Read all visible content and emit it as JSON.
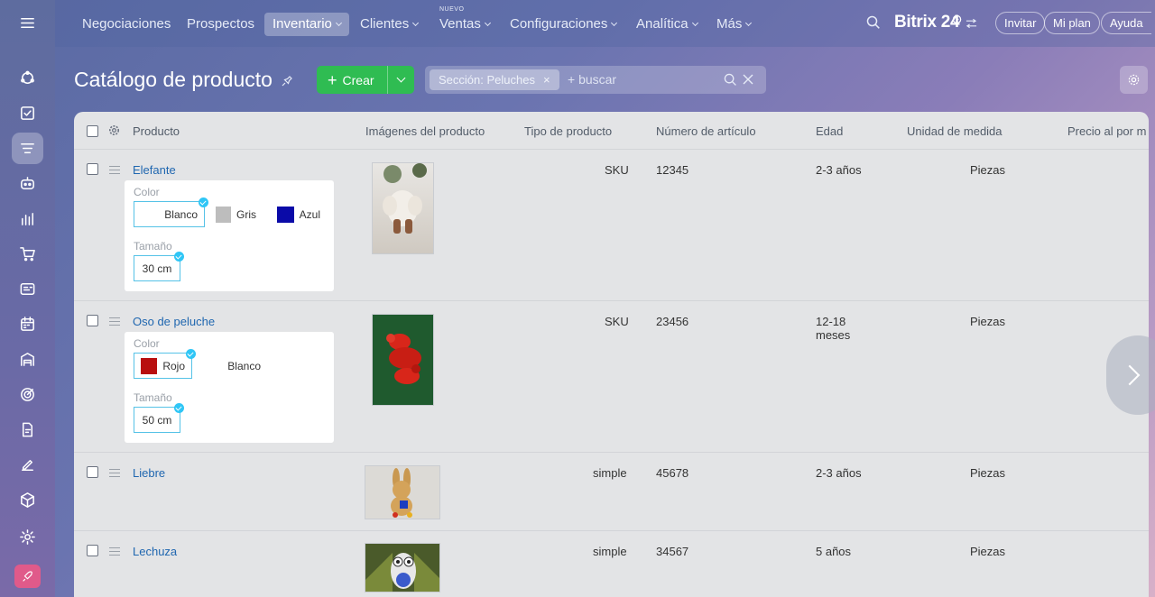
{
  "nav": {
    "items": [
      "Negociaciones",
      "Prospectos",
      "Inventario",
      "Clientes",
      "Ventas",
      "Configuraciones",
      "Analítica",
      "Más"
    ],
    "new_badge": "NUEVO"
  },
  "header": {
    "brand": "Bitrix 24",
    "invite": "Invitar",
    "plan": "Mi plan",
    "help": "Ayuda"
  },
  "page": {
    "title": "Catálogo de producto",
    "create_label": "Crear",
    "filter_tag": "Sección: Peluches",
    "search_placeholder": "+ buscar"
  },
  "table": {
    "columns": [
      "Producto",
      "Imágenes del producto",
      "Tipo de producto",
      "Número de artículo",
      "Edad",
      "Unidad de medida",
      "Precio al por m"
    ],
    "rows": [
      {
        "name": "Elefante",
        "type": "SKU",
        "article": "12345",
        "age": "2-3 años",
        "unit": "Piezas",
        "props": {
          "color_label": "Color",
          "size_label": "Tamaño",
          "colors": [
            "Blanco",
            "Gris",
            "Azul"
          ],
          "size": "30 cm"
        }
      },
      {
        "name": "Oso de peluche",
        "type": "SKU",
        "article": "23456",
        "age": "12-18 meses",
        "unit": "Piezas",
        "props": {
          "color_label": "Color",
          "size_label": "Tamaño",
          "colors": [
            "Rojo",
            "Blanco"
          ],
          "size": "50 cm"
        }
      },
      {
        "name": "Liebre",
        "type": "simple",
        "article": "45678",
        "age": "2-3 años",
        "unit": "Piezas"
      },
      {
        "name": "Lechuza",
        "type": "simple",
        "article": "34567",
        "age": "5 años",
        "unit": "Piezas"
      }
    ]
  },
  "colors": {
    "accent": "#2fbc52",
    "link": "#2067b0",
    "selection": "#55c2e7",
    "gris": "#bdbdbd",
    "azul": "#0a0aa8",
    "rojo": "#b80f0f"
  }
}
